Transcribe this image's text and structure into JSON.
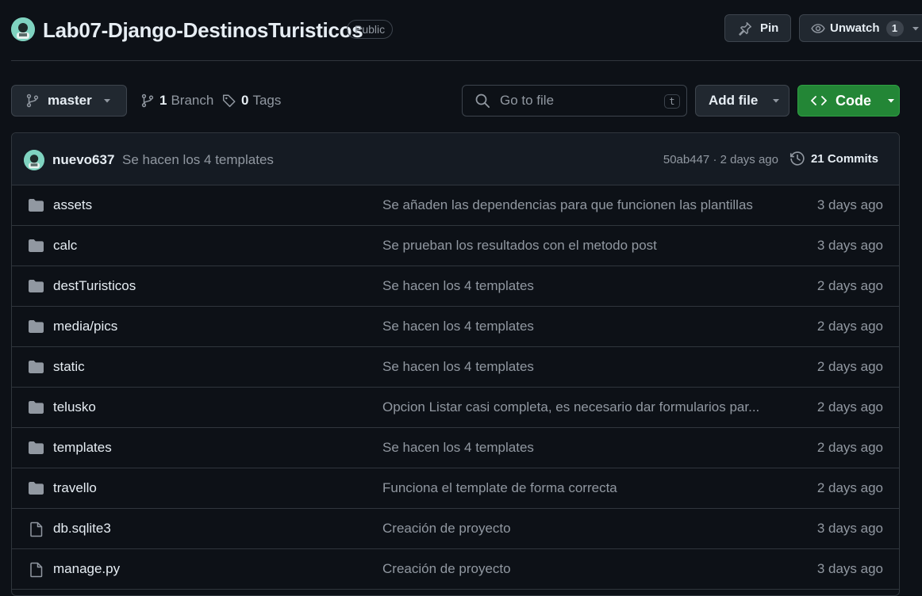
{
  "header": {
    "repo_name": "Lab07-Django-DestinosTuristicos",
    "visibility": "Public",
    "pin_label": "Pin",
    "watch_label": "Unwatch",
    "watch_count": "1"
  },
  "toolbar": {
    "branch": "master",
    "branch_count": "1",
    "branch_label": "Branch",
    "tag_count": "0",
    "tag_label": "Tags",
    "search_placeholder": "Go to file",
    "search_shortcut": "t",
    "add_file_label": "Add file",
    "code_label": "Code"
  },
  "latest_commit": {
    "author": "nuevo637",
    "message": "Se hacen los 4 templates",
    "meta": "50ab447 · 2 days ago",
    "commits_label": "21 Commits"
  },
  "files": [
    {
      "type": "folder",
      "name": "assets",
      "message": "Se añaden las dependencias para que funcionen las plantillas",
      "age": "3 days ago"
    },
    {
      "type": "folder",
      "name": "calc",
      "message": "Se prueban los resultados con el metodo post",
      "age": "3 days ago"
    },
    {
      "type": "folder",
      "name": "destTuristicos",
      "message": "Se hacen los 4 templates",
      "age": "2 days ago"
    },
    {
      "type": "folder",
      "name": "media/pics",
      "message": "Se hacen los 4 templates",
      "age": "2 days ago"
    },
    {
      "type": "folder",
      "name": "static",
      "message": "Se hacen los 4 templates",
      "age": "2 days ago"
    },
    {
      "type": "folder",
      "name": "telusko",
      "message": "Opcion Listar casi completa, es necesario dar formularios par...",
      "age": "2 days ago"
    },
    {
      "type": "folder",
      "name": "templates",
      "message": "Se hacen los 4 templates",
      "age": "2 days ago"
    },
    {
      "type": "folder",
      "name": "travello",
      "message": "Funciona el template de forma correcta",
      "age": "2 days ago"
    },
    {
      "type": "file",
      "name": "db.sqlite3",
      "message": "Creación de proyecto",
      "age": "3 days ago"
    },
    {
      "type": "file",
      "name": "manage.py",
      "message": "Creación de proyecto",
      "age": "3 days ago"
    }
  ],
  "colors": {
    "background": "#0d1117",
    "accent_green": "#238636",
    "muted_text": "#9198a1",
    "border": "#30363d"
  }
}
